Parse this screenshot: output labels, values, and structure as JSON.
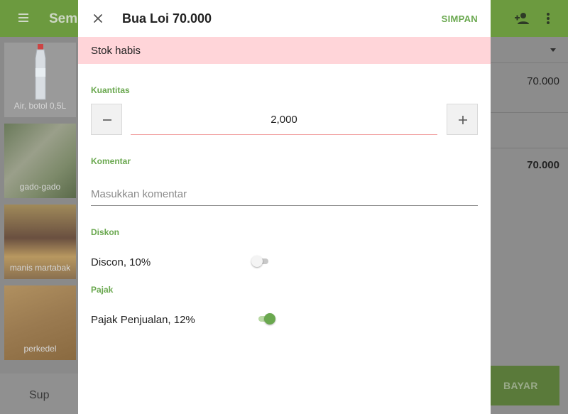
{
  "background": {
    "appbar_title": "Semu",
    "items": [
      {
        "label": "Air, botol 0,5L"
      },
      {
        "label": "gado-gado"
      },
      {
        "label": "manis martabak"
      },
      {
        "label": "perkedel"
      }
    ],
    "bottom_left_label": "Sup",
    "totals": {
      "line_amount": "70.000",
      "total_amount": "70.000"
    },
    "pay_label": "BAYAR"
  },
  "dialog": {
    "title": "Bua Loi 70.000",
    "save_label": "SIMPAN",
    "stock_banner": "Stok habis",
    "quantity": {
      "label": "Kuantitas",
      "value": "2,000"
    },
    "comment": {
      "label": "Komentar",
      "placeholder": "Masukkan komentar",
      "value": ""
    },
    "discount": {
      "label": "Diskon",
      "item_label": "Discon, 10%",
      "enabled": false
    },
    "tax": {
      "label": "Pajak",
      "item_label": "Pajak Penjualan, 12%",
      "enabled": true
    }
  },
  "colors": {
    "accent": "#6aa84f",
    "banner_bg": "#ffd5d9",
    "appbar": "#6c9a3f"
  },
  "icons": {
    "menu": "menu-icon",
    "add_person": "person-add-icon",
    "more": "more-vert-icon",
    "close": "close-icon",
    "minus": "minus-icon",
    "plus": "plus-icon",
    "dropdown": "dropdown-arrow-icon"
  }
}
